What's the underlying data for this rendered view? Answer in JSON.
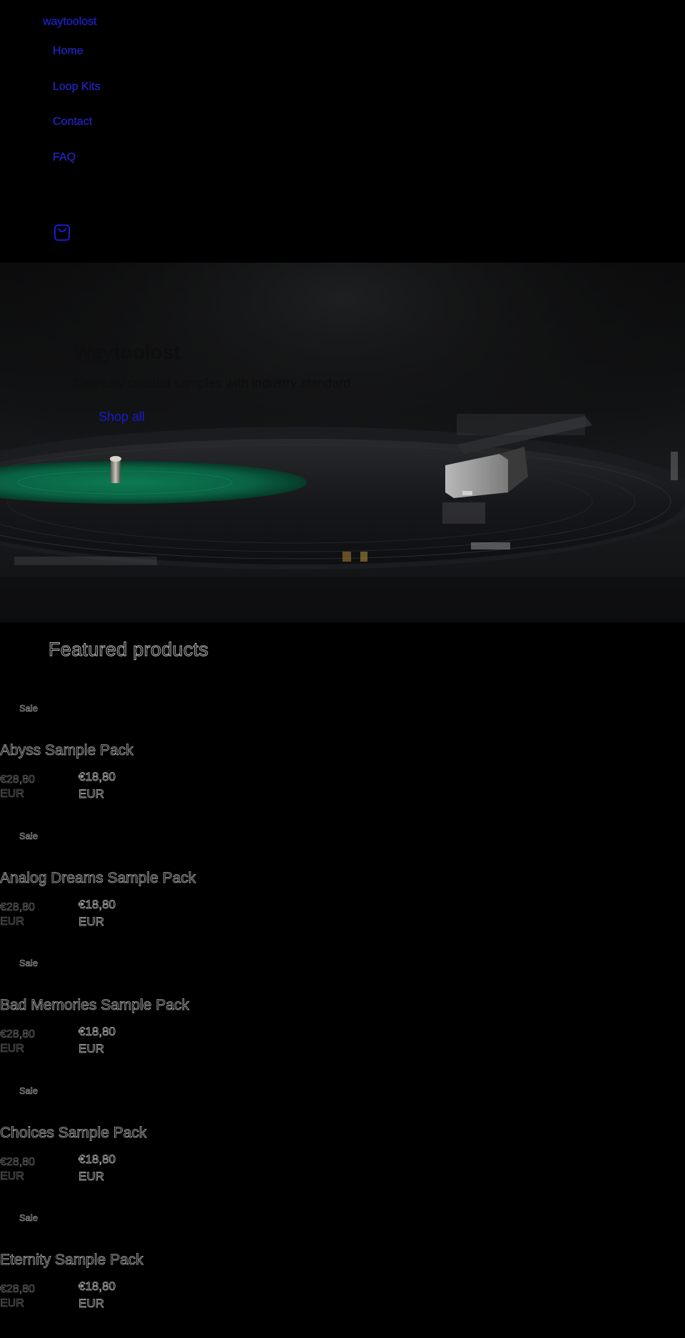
{
  "header": {
    "logo": "waytoolost",
    "nav": [
      {
        "label": "Home"
      },
      {
        "label": "Loop Kits"
      },
      {
        "label": "Contact"
      },
      {
        "label": "FAQ"
      }
    ],
    "cart_icon": "cart-bag-icon"
  },
  "hero": {
    "title": "Waytoolost",
    "subtitle": "Carefully created samples with industry standard.",
    "button": "Shop all"
  },
  "featured": {
    "title": "Featured products",
    "products": [
      {
        "badge": "Sale",
        "title": "Abyss Sample Pack",
        "regular_price": "€28,80",
        "regular_currency": "EUR",
        "sale_price": "€18,80",
        "sale_currency": "EUR"
      },
      {
        "badge": "Sale",
        "title": "Analog Dreams Sample Pack",
        "regular_price": "€28,80",
        "regular_currency": "EUR",
        "sale_price": "€18,80",
        "sale_currency": "EUR"
      },
      {
        "badge": "Sale",
        "title": "Bad Memories Sample Pack",
        "regular_price": "€28,80",
        "regular_currency": "EUR",
        "sale_price": "€18,80",
        "sale_currency": "EUR"
      },
      {
        "badge": "Sale",
        "title": "Choices Sample Pack",
        "regular_price": "€28,80",
        "regular_currency": "EUR",
        "sale_price": "€18,80",
        "sale_currency": "EUR"
      },
      {
        "badge": "Sale",
        "title": "Eternity Sample Pack",
        "regular_price": "€28,80",
        "regular_currency": "EUR",
        "sale_price": "€18,80",
        "sale_currency": "EUR"
      }
    ]
  },
  "colors": {
    "background": "#000000",
    "link": "#1a1acc",
    "record_label": "#0a6e4a"
  }
}
